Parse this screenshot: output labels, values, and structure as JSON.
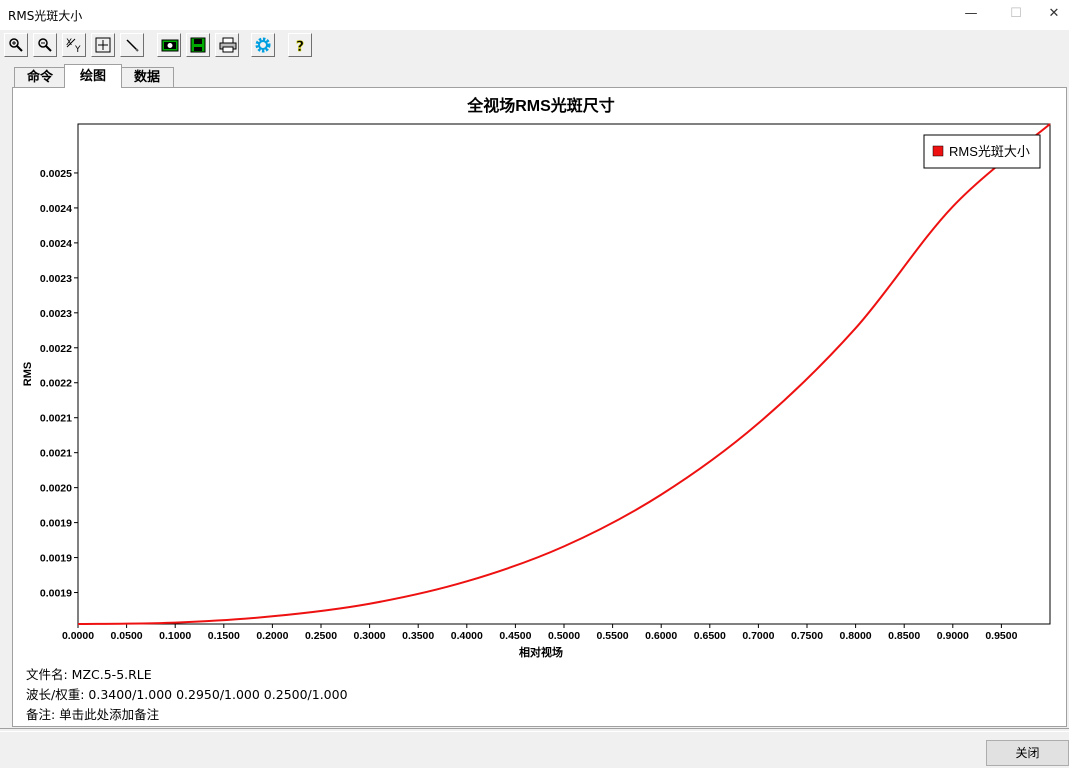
{
  "window": {
    "title": "RMS光斑大小",
    "minimize": "—",
    "maximize": "☐",
    "close": "✕"
  },
  "toolbar": {
    "buttons": [
      {
        "name": "zoom-in-icon"
      },
      {
        "name": "zoom-out-icon"
      },
      {
        "name": "xy-scale-icon"
      },
      {
        "name": "fit-icon"
      },
      {
        "name": "pen-icon"
      },
      {
        "name": "camera-icon"
      },
      {
        "name": "save-icon"
      },
      {
        "name": "print-icon"
      },
      {
        "name": "settings-gear-icon"
      },
      {
        "name": "help-icon"
      }
    ]
  },
  "tabs": [
    "命令",
    "绘图",
    "数据"
  ],
  "active_tab": 1,
  "info": {
    "filename": "文件名:  MZC.5-5.RLE",
    "wavelength": "波长/权重:  0.3400/1.000  0.2950/1.000  0.2500/1.000",
    "note": "备注:  单击此处添加备注"
  },
  "close_button": "关闭",
  "colors": {
    "series": "#ee1111",
    "background": "#f0f0f0"
  },
  "chart_data": {
    "type": "line",
    "title": "全视场RMS光斑尺寸",
    "xlabel": "相对视场",
    "ylabel": "RMS",
    "xlim": [
      0,
      1
    ],
    "ylim": [
      0.00184,
      0.002555
    ],
    "xticks": [
      "0.0000",
      "0.0500",
      "0.1000",
      "0.1500",
      "0.2000",
      "0.2500",
      "0.3000",
      "0.3500",
      "0.4000",
      "0.4500",
      "0.5000",
      "0.5500",
      "0.6000",
      "0.6500",
      "0.7000",
      "0.7500",
      "0.8000",
      "0.8500",
      "0.9000",
      "0.9500"
    ],
    "yticks": [
      {
        "value": 0.001885,
        "label": "0.0019"
      },
      {
        "value": 0.001935,
        "label": "0.0019"
      },
      {
        "value": 0.001985,
        "label": "0.0019"
      },
      {
        "value": 0.002035,
        "label": "0.0020"
      },
      {
        "value": 0.002085,
        "label": "0.0021"
      },
      {
        "value": 0.002135,
        "label": "0.0021"
      },
      {
        "value": 0.002185,
        "label": "0.0022"
      },
      {
        "value": 0.002235,
        "label": "0.0022"
      },
      {
        "value": 0.002285,
        "label": "0.0023"
      },
      {
        "value": 0.002335,
        "label": "0.0023"
      },
      {
        "value": 0.002385,
        "label": "0.0024"
      },
      {
        "value": 0.002435,
        "label": "0.0024"
      },
      {
        "value": 0.002485,
        "label": "0.0025"
      }
    ],
    "grid": false,
    "legend": {
      "position": "top-right",
      "entries": [
        "RMS光斑大小"
      ]
    },
    "series": [
      {
        "name": "RMS光斑大小",
        "x": [
          0,
          0.1,
          0.2,
          0.3,
          0.4,
          0.5,
          0.6,
          0.7,
          0.8,
          0.9,
          1.0
        ],
        "values": [
          0.00184,
          0.001842,
          0.001851,
          0.001869,
          0.001901,
          0.001951,
          0.002025,
          0.002127,
          0.002263,
          0.002437,
          0.002555
        ]
      }
    ]
  }
}
